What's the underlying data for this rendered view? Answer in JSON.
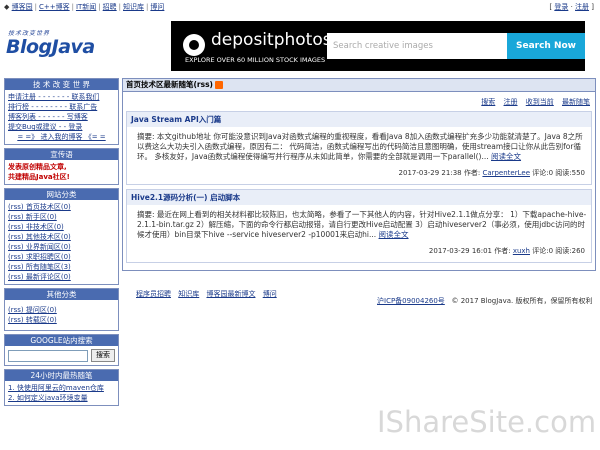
{
  "topnav": [
    "博客园",
    "C++博客",
    "IT新闻",
    "招聘",
    "知识库",
    "博问"
  ],
  "toplinks": {
    "login": "登录",
    "register": "注册"
  },
  "logo": {
    "subtitle": "技术改变世界",
    "name": "BlogJava"
  },
  "ad": {
    "brand": "depositphotos",
    "tagline": "EXPLORE OVER 60 MILLION STOCK IMAGES",
    "search_placeholder": "Search creative images",
    "search_button": "Search Now"
  },
  "sidebar": {
    "tech": {
      "title": "技 术 改 变 世 界",
      "items": [
        "申请注册 - - - - - - - 联系我们",
        "排行榜 - - - - - - - - 联系广告",
        "博客列表 - - - - - - 写博客",
        "提交Bug或建议 - - 登录",
        "= =》 进入我的博客 《= ="
      ]
    },
    "promo": {
      "title": "宣传语",
      "line1": "发表原创精品文章,",
      "line2": "共建精品Java社区!"
    },
    "categories": {
      "title": "网站分类",
      "items": [
        "(rss) 首页技术区(0)",
        "(rss) 新手区(0)",
        "(rss) 非技术区(0)",
        "(rss) 其他技术区(0)",
        "(rss) 业界新闻区(0)",
        "(rss) 求职招聘区(0)",
        "(rss) 所有随笔区(3)",
        "(rss) 最新评论区(0)"
      ]
    },
    "others": {
      "title": "其他分类",
      "items": [
        "(rss) 提问区(0)",
        "(rss) 转载区(0)"
      ]
    },
    "google": {
      "title": "GOOGLE站内搜索",
      "button": "搜索"
    },
    "hot": {
      "title": "24小时内最热随笔",
      "items": [
        "1. 快使用阿里云的maven仓库",
        "2. 如何定义java环境变量"
      ]
    }
  },
  "main": {
    "title": "首页技术区最新随笔(rss)",
    "actions": [
      "搜索",
      "注册",
      "收到当前",
      "最新随笔"
    ],
    "posts": [
      {
        "title": "Java Stream API入门篇",
        "body": "摘要: 本文github地址 你可能没意识到Java对函数式编程的重视程度，看看Java 8加入函数式编程扩充多少功能就清楚了。Java 8之所以费这么大功夫引入函数式编程，原因有二： 代码简洁，函数式编程写出的代码简洁且意图明确，使用stream接口让你从此告别for循环。 多核友好，Java函数式编程使得编写并行程序从未如此简单，你需要的全部就是调用一下parallel()...",
        "more": "阅读全文",
        "meta_date": "2017-03-29 21:38 作者:",
        "author": "CarpenterLee",
        "meta_stats": "评论:0 阅读:550"
      },
      {
        "title": "Hive2.1源码分析(一) 启动脚本",
        "body": "摘要: 最近在网上看到的相关材料都比较陈旧，也太简略，参看了一下其他人的内容，针对Hive2.1.1做点分享： 1）下载apache-hive-2.1.1-bin.tar.gz 2）解压缩，下面的命令行都启动报错，请自行更改Hive启动配置 3）启动hiveserver2（事必须，使用jdbc访问的时候才使用）bin目录下hive --service hiveserver2 -p10001来启动hi...",
        "more": "阅读全文",
        "meta_date": "2017-03-29 16:01 作者:",
        "author": "xuxh",
        "meta_stats": "评论:0 阅读:260"
      }
    ]
  },
  "footer": {
    "links": [
      "程序员招聘",
      "知识库",
      "博客园最新博文",
      "博问"
    ],
    "icp": "沪ICP备09004260号",
    "copyright": "© 2017 BlogJava. 版权所有，保留所有权利"
  },
  "watermark": "IShareSite.com"
}
